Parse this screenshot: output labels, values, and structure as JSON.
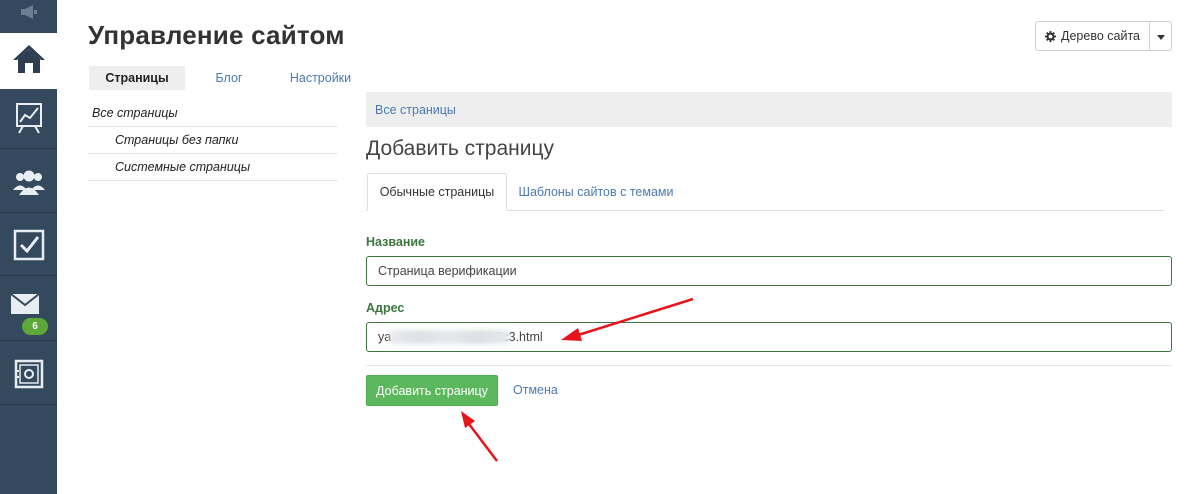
{
  "page": {
    "title": "Управление сайтом"
  },
  "header": {
    "tree_button_label": "Дерево сайта",
    "tree_button_icon": "gear-icon",
    "dropdown_icon": "caret-down-icon"
  },
  "sidebar": {
    "top_icon": "megaphone-icon",
    "items": [
      {
        "icon": "home-icon",
        "active": true
      },
      {
        "icon": "chart-icon",
        "active": false
      },
      {
        "icon": "users-icon",
        "active": false
      },
      {
        "icon": "checkbox-icon",
        "active": false
      },
      {
        "icon": "mail-icon",
        "active": false,
        "badge": "6"
      },
      {
        "icon": "safe-icon",
        "active": false
      }
    ]
  },
  "tabs": [
    {
      "label": "Страницы",
      "active": true
    },
    {
      "label": "Блог",
      "active": false
    },
    {
      "label": "Настройки",
      "active": false
    }
  ],
  "left_list": [
    {
      "label": "Все страницы",
      "level": 0
    },
    {
      "label": "Страницы без папки",
      "level": 1
    },
    {
      "label": "Системные страницы",
      "level": 1
    }
  ],
  "breadcrumb": "Все страницы",
  "form": {
    "heading": "Добавить страницу",
    "subtabs": [
      {
        "label": "Обычные страницы",
        "active": true
      },
      {
        "label": "Шаблоны сайтов с темами",
        "active": false
      }
    ],
    "name_label": "Название",
    "name_value": "Страница верификации",
    "address_label": "Адрес",
    "address_value": "ya                              9c3.html",
    "submit_label": "Добавить страницу",
    "cancel_label": "Отмена"
  },
  "colors": {
    "sidebar_bg": "#34495e",
    "accent_green": "#5cb85c",
    "label_green": "#3c763d",
    "link_blue": "#4a7ab0",
    "annotation_red": "#e8141b"
  }
}
